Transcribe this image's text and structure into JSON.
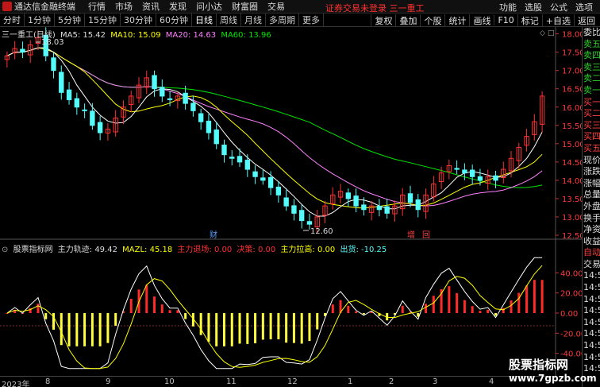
{
  "menubar": {
    "app_name": "通达信金融终端",
    "items": [
      "行情",
      "市场",
      "资讯",
      "发现",
      "问小达",
      "财富圈",
      "交易"
    ],
    "login_warning": "证券交易未登录",
    "stock_name": "三一重工",
    "right_items": [
      "功能",
      "选股",
      "公式",
      "选项"
    ]
  },
  "toolbar": {
    "periods": [
      "分时",
      "1分钟",
      "5分钟",
      "15分钟",
      "30分钟",
      "60分钟",
      "日线",
      "周线",
      "月线",
      "多周期",
      "更多"
    ],
    "active_period": "日线",
    "tools": [
      "复权",
      "叠加",
      "个股",
      "统计",
      "画线",
      "F10",
      "标记",
      "+自选",
      "返回"
    ]
  },
  "main_legend": {
    "title": "三一重工(日线)",
    "ma5": "MA5: 15.42",
    "ma10": "MA10: 15.09",
    "ma20": "MA20: 14.63",
    "ma60": "MA60: 13.96"
  },
  "sub_legend": {
    "title": "股票指标网",
    "main_track": "主力轨迹: 49.42",
    "mazl": "MAZL: 45.18",
    "main_retreat": "主力退场: 0.00",
    "decision": "决策: 0.00",
    "main_pull": "主力拉高: 0.00",
    "exit": "出货: -10.25"
  },
  "price_axis": [
    "18.00",
    "17.50",
    "17.00",
    "16.50",
    "16.00",
    "15.50",
    "15.00",
    "14.50",
    "14.00",
    "13.50",
    "13.00",
    "12.50"
  ],
  "indicator_axis": [
    "40.00",
    "20.00",
    "0.00",
    "-20.00",
    "-40.00"
  ],
  "annotations": {
    "high": "18.03",
    "low": "12.60",
    "marker_cai": "财",
    "marker_zeng": "增",
    "marker_hui": "回"
  },
  "right_panel": [
    "委比",
    "卖五",
    "卖四",
    "卖三",
    "卖二",
    "卖一",
    "买一",
    "买二",
    "买三",
    "买四",
    "买五",
    "现价",
    "涨跌",
    "涨幅",
    "总量",
    "外盘",
    "换手",
    "净资",
    "收益",
    "自动",
    "交易",
    "14:56",
    "14:56",
    "14:56",
    "14:56",
    "14:56",
    "14:56",
    "14:56",
    "14:56",
    "14:56"
  ],
  "time_axis": [
    "2023年",
    "8",
    "9",
    "10",
    "11",
    "12",
    "1",
    "2",
    "3",
    "4"
  ],
  "watermark": {
    "line1": "股票指标网",
    "line2": "www.7gpzb.com"
  },
  "colors": {
    "up": "#ff3232",
    "down": "#54fcfc",
    "ma5": "#ffffff",
    "ma10": "#ffff00",
    "ma20": "#ff80ff",
    "ma60": "#00e600",
    "hist_red": "#ff2a2a",
    "hist_yellow": "#ffff40"
  },
  "chart_data": {
    "type": "candlestick",
    "period": "日线",
    "price_range": [
      12.5,
      18.1
    ],
    "close": [
      17.4,
      17.6,
      17.5,
      17.7,
      17.9,
      17.4,
      17.0,
      16.4,
      16.2,
      16.0,
      15.9,
      15.5,
      15.3,
      15.4,
      15.7,
      16.0,
      16.3,
      16.6,
      16.8,
      16.5,
      16.3,
      16.2,
      16.3,
      16.1,
      15.9,
      15.6,
      15.3,
      15.0,
      14.7,
      14.6,
      14.5,
      14.3,
      14.1,
      14.0,
      13.8,
      13.6,
      13.3,
      13.1,
      12.9,
      12.8,
      13.0,
      13.3,
      13.6,
      13.7,
      13.5,
      13.3,
      13.2,
      13.3,
      13.2,
      13.1,
      13.3,
      13.6,
      13.4,
      13.2,
      13.6,
      13.9,
      14.2,
      14.4,
      14.3,
      14.2,
      14.1,
      14.0,
      14.1,
      14.0,
      14.3,
      14.6,
      14.9,
      15.2,
      15.6,
      16.3
    ],
    "ma_legend": {
      "MA5": 15.42,
      "MA10": 15.09,
      "MA20": 14.63,
      "MA60": 13.96
    },
    "indicator": {
      "main_track": 49.42,
      "MAZL": 45.18,
      "main_retreat": 0.0,
      "decision": 0.0,
      "main_pull": 0.0,
      "exit": -10.25
    }
  }
}
